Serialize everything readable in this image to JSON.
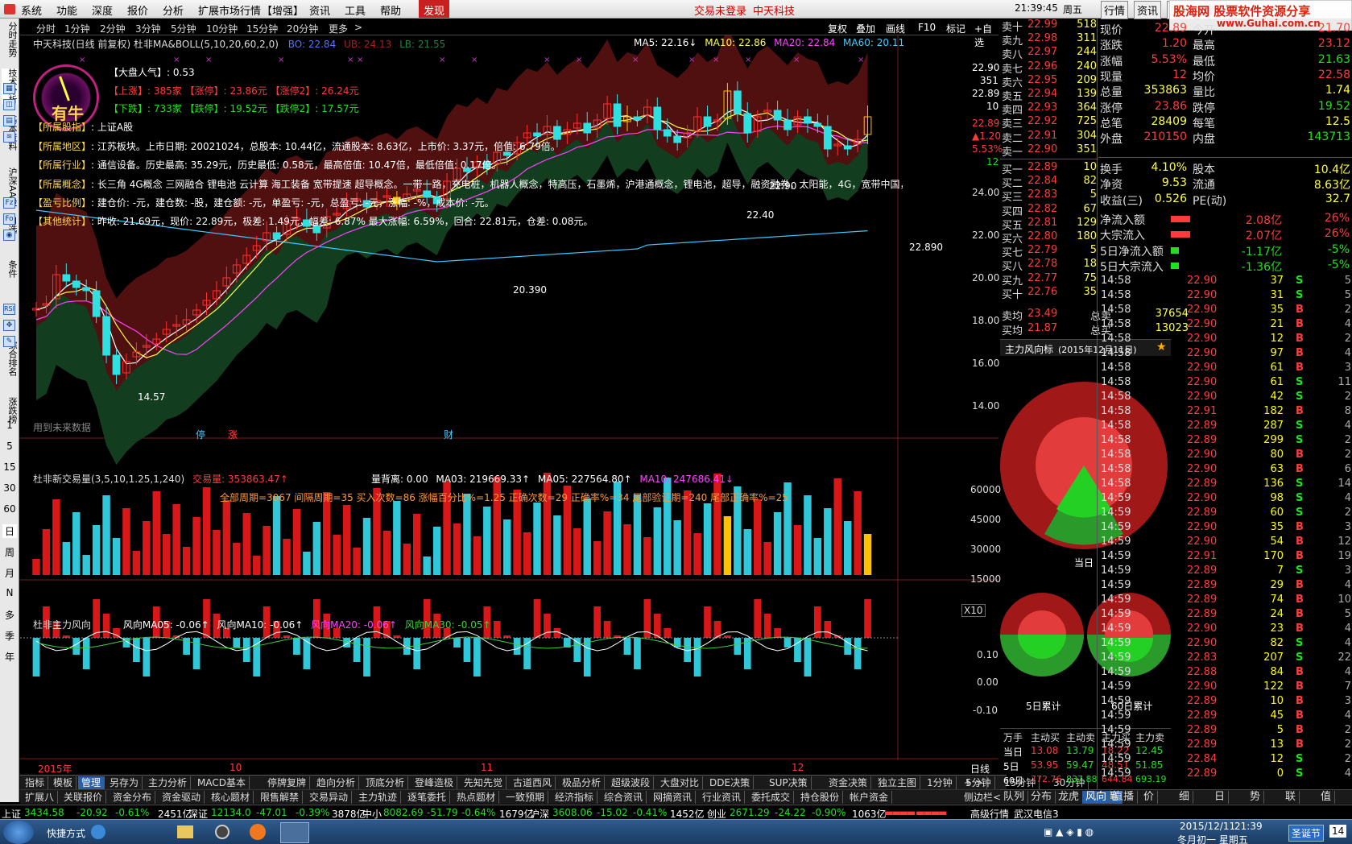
{
  "menubar": {
    "items": [
      "系统",
      "功能",
      "深度",
      "报价",
      "分析",
      "扩展市场行情",
      "【增强】",
      "资讯",
      "工具",
      "帮助",
      "发现"
    ],
    "login_status": "交易未登录",
    "app_name": "中天科技",
    "time": "21:39:45",
    "weekday": "周五",
    "right_buttons": [
      "行情",
      "资讯",
      "交易",
      "服务"
    ],
    "watermark": "股海网 股票软件资源分享",
    "watermark_url": "www.Guhai.com.cn"
  },
  "leftbar": {
    "tabs": [
      "分时走势",
      "技术分析",
      "基本资料",
      "沪深AA股",
      "自选",
      "条件",
      "综合排名",
      "涨跌榜",
      "日"
    ],
    "periods": [
      "1",
      "5",
      "15",
      "30",
      "60",
      "日",
      "周",
      "月",
      "N",
      "多",
      "季",
      "年"
    ]
  },
  "periodbar": {
    "items": [
      "分时",
      "1分钟",
      "2分钟",
      "3分钟",
      "5分钟",
      "10分钟",
      "15分钟",
      "20分钟",
      "更多"
    ],
    "right_items": [
      "复权",
      "叠加",
      "画线",
      "F10",
      "标记",
      "+自选"
    ]
  },
  "main_chart": {
    "title": "中天科技(日线 前复权) 杜非MA&BOLL(5,10,20,60,2,0)",
    "boll": {
      "bo": "BO: 22.84",
      "ub": "UB: 24.13",
      "lb": "LB: 21.55"
    },
    "ma5": "MA5: 22.16↓",
    "ma10": "MA10: 22.86",
    "ma20": "MA20: 22.84",
    "ma60": "MA60: 20.11",
    "gauge_label": "有牛",
    "info_lines": [
      {
        "label": "【大盘人气】",
        "text": ": 0.53"
      },
      {
        "label": "【上涨】",
        "text": ": 385家   【涨停】: 23.86元   【涨停2】: 26.24元"
      },
      {
        "label": "【下跌】",
        "text": ": 733家   【跌停】: 19.52元   【跌停2】: 17.57元"
      },
      {
        "label": "【所属股指】",
        "text": ": 上证A股"
      },
      {
        "label": "【所属地区】",
        "text": ": 江苏板块。上市日期: 20021024，总股本: 10.44亿，流通股本: 8.63亿，上市价: 3.37元，倍值: 6.79倍。"
      },
      {
        "label": "【所属行业】",
        "text": ": 通信设备。历史最高: 35.29元，历史最低: 0.58元，最高倍值: 10.47倍，最低倍值: 0.17倍。"
      },
      {
        "label": "【所属概念】",
        "text": ": 长三角 4G概念 三网融合 锂电池 云计算 海工装备 宽带提速 超导概念。一带一路，充电桩，机器人概念，特高压，石墨烯，沪港通概念，锂电池，超导，融资融券，太阳能，4G，宽带中国，新能源，海"
      },
      {
        "label": "【盈亏比例】",
        "text": ": 建仓价: -元，建仓数: -股，建仓额: -元，单盈亏: -元，总盈亏: -元，涨幅: -%，成本价: -元。"
      },
      {
        "label": "【其他统计】",
        "text": ": 昨收: 21.69元，现价: 22.89元，极差: 1.49元，幅差: 6.87% 最大涨幅: 6.59%，回合: 22.81元，仓差: 0.08元。"
      }
    ],
    "future_note": "用到未来数据",
    "annotations": [
      "14.57",
      "20.390",
      "22.890",
      "22.40",
      "22.90"
    ],
    "y_ticks": [
      "24.00",
      "22.00",
      "20.00",
      "18.00",
      "16.00",
      "14.00"
    ],
    "right_labels": [
      "22.90",
      "351",
      "22.89",
      "10",
      "22.89",
      "▲1.20",
      "5.53%",
      "12"
    ],
    "markers": [
      "停",
      "涨",
      "财"
    ]
  },
  "volume_chart": {
    "title": "杜非新交易量(3,5,10,1.25,1,240)",
    "vol": "交易量: 353863.47↑",
    "li_bei_li": "量背离: 0.00",
    "ma03": "MA03: 219669.33↑",
    "ma05": "MA05: 227564.80↑",
    "ma10": "MA10: 247686.41↓",
    "stats": "全部周期=3067  间隔周期=35  买入次数=86  涨幅百分比%=1.25  正确次数=29  正确率%=34  尾部验证期=240  尾部正确率%=25",
    "y_ticks": [
      "60000",
      "45000",
      "30000",
      "15000"
    ],
    "unit": "X10"
  },
  "wind_chart": {
    "title": "杜非主力风向",
    "ma05": "风向MA05: -0.06↑",
    "ma10": "风向MA10: -0.06↑",
    "ma20": "风向MA20: -0.06↑",
    "ma30": "风向MA30: -0.05↑",
    "y_ticks": [
      "0.10",
      "0.00",
      "-0.10"
    ]
  },
  "x_axis": {
    "labels": [
      "2015年",
      "10",
      "11",
      "12"
    ],
    "right": "日线"
  },
  "bottom_tabs1": [
    "指标",
    "模板",
    "管理",
    "另存为",
    "主力分析",
    "MACD基本",
    "停牌复牌",
    "趋向分析",
    "顶底分析",
    "登峰造极",
    "先知先觉",
    "古道西风",
    "极品分析",
    "超级波段",
    "大盘对比",
    "DDE决策",
    "SUP决策",
    "资金决策",
    "独立主图",
    "1分钟",
    "5分钟",
    "15分钟",
    "30分钟"
  ],
  "bottom_tabs2": [
    "扩展八",
    "关联报价",
    "资金分布",
    "资金驱动",
    "核心题材",
    "限售解禁",
    "交易异动",
    "主力轨迹",
    "逐笔委托",
    "热点题材",
    "一致预期",
    "经济指标",
    "综合资讯",
    "网摘资讯",
    "行业资讯",
    "委托成交",
    "持仓股份",
    "帐户资金"
  ],
  "bottom_right": "侧边栏<",
  "quote": {
    "asks": [
      {
        "label": "卖十",
        "price": "22.99",
        "vol": "518"
      },
      {
        "label": "卖九",
        "price": "22.98",
        "vol": "311"
      },
      {
        "label": "卖八",
        "price": "22.97",
        "vol": "244"
      },
      {
        "label": "卖七",
        "price": "22.96",
        "vol": "240"
      },
      {
        "label": "卖六",
        "price": "22.95",
        "vol": "209"
      },
      {
        "label": "卖五",
        "price": "22.94",
        "vol": "139"
      },
      {
        "label": "卖四",
        "price": "22.93",
        "vol": "364"
      },
      {
        "label": "卖三",
        "price": "22.92",
        "vol": "725"
      },
      {
        "label": "卖二",
        "price": "22.91",
        "vol": "304"
      },
      {
        "label": "卖一",
        "price": "22.90",
        "vol": "351"
      }
    ],
    "bids": [
      {
        "label": "买一",
        "price": "22.89",
        "vol": "10"
      },
      {
        "label": "买二",
        "price": "22.84",
        "vol": "82"
      },
      {
        "label": "买三",
        "price": "22.83",
        "vol": "5"
      },
      {
        "label": "买四",
        "price": "22.82",
        "vol": "67"
      },
      {
        "label": "买五",
        "price": "22.81",
        "vol": "129"
      },
      {
        "label": "买六",
        "price": "22.80",
        "vol": "180"
      },
      {
        "label": "买七",
        "price": "22.79",
        "vol": "5"
      },
      {
        "label": "买八",
        "price": "22.78",
        "vol": "18"
      },
      {
        "label": "买九",
        "price": "22.77",
        "vol": "75"
      },
      {
        "label": "买十",
        "price": "22.76",
        "vol": "35"
      }
    ],
    "avg": [
      {
        "label": "卖均",
        "price": "23.49",
        "k": "总卖",
        "v": "37654"
      },
      {
        "label": "买均",
        "price": "21.87",
        "k": "总买",
        "v": "13023"
      }
    ],
    "stats": [
      {
        "k1": "现价",
        "v1": "22.89",
        "k2": "今开",
        "v2": "21.70"
      },
      {
        "k1": "涨跌",
        "v1": "1.20",
        "k2": "最高",
        "v2": "23.12"
      },
      {
        "k1": "涨幅",
        "v1": "5.53%",
        "k2": "最低",
        "v2": "21.63"
      },
      {
        "k1": "现量",
        "v1": "12",
        "k2": "均价",
        "v2": "22.58"
      },
      {
        "k1": "总量",
        "v1": "353863",
        "k2": "量比",
        "v2": "1.74"
      },
      {
        "k1": "涨停",
        "v1": "23.86",
        "k2": "跌停",
        "v2": "19.52"
      },
      {
        "k1": "总笔",
        "v1": "28409",
        "k2": "每笔",
        "v2": "12.5"
      },
      {
        "k1": "外盘",
        "v1": "210150",
        "k2": "内盘",
        "v2": "143713"
      }
    ],
    "stats2": [
      {
        "k1": "换手",
        "v1": "4.10%",
        "k2": "股本",
        "v2": "10.4亿"
      },
      {
        "k1": "净资",
        "v1": "9.53",
        "k2": "流通",
        "v2": "8.63亿"
      },
      {
        "k1": "收益(三)",
        "v1": "0.526",
        "k2": "PE(动)",
        "v2": "32.7"
      }
    ],
    "flows": [
      {
        "k": "净流入额",
        "v": "2.08亿",
        "p": "26%",
        "bar": "red",
        "ratio": 0.6
      },
      {
        "k": "大宗流入",
        "v": "2.07亿",
        "p": "26%",
        "bar": "red",
        "ratio": 0.6
      },
      {
        "k": "5日净流入额",
        "v": "-1.17亿",
        "p": "-5%",
        "bar": "green",
        "ratio": 0.25
      },
      {
        "k": "5日大宗流入",
        "v": "-1.36亿",
        "p": "-5%",
        "bar": "green",
        "ratio": 0.25
      }
    ]
  },
  "wind_panel": {
    "title": "主力风向标",
    "date": "(2015年12月11日)",
    "labels": [
      "当日",
      "5日累计",
      "60日累计"
    ],
    "table_header": [
      "万手",
      "主动买",
      "主动卖",
      "主力买",
      "主力卖"
    ],
    "table_rows": [
      [
        "当日",
        "13.08",
        "13.79",
        "18.22",
        "12.45"
      ],
      [
        "5日",
        "53.95",
        "59.47",
        "48.51",
        "51.85"
      ],
      [
        "60日",
        "772.76",
        "837.88",
        "644.84",
        "693.19"
      ]
    ],
    "tabs": [
      "队列",
      "分布",
      "龙虎",
      "风向",
      "直播"
    ]
  },
  "ticks": [
    [
      "14:58",
      "22.90",
      "37",
      "S",
      "5"
    ],
    [
      "14:58",
      "22.90",
      "31",
      "S",
      "5"
    ],
    [
      "14:58",
      "22.90",
      "35",
      "B",
      "2"
    ],
    [
      "14:58",
      "22.90",
      "21",
      "B",
      "4"
    ],
    [
      "14:58",
      "22.90",
      "12",
      "B",
      "2"
    ],
    [
      "14:58",
      "22.90",
      "97",
      "B",
      "4"
    ],
    [
      "14:58",
      "22.90",
      "61",
      "B",
      "3"
    ],
    [
      "14:58",
      "22.90",
      "61",
      "S",
      "11"
    ],
    [
      "14:58",
      "22.90",
      "42",
      "S",
      "2"
    ],
    [
      "14:58",
      "22.91",
      "182",
      "B",
      "8"
    ],
    [
      "14:58",
      "22.89",
      "287",
      "S",
      "4"
    ],
    [
      "14:58",
      "22.89",
      "299",
      "S",
      "2"
    ],
    [
      "14:58",
      "22.90",
      "80",
      "B",
      "2"
    ],
    [
      "14:58",
      "22.90",
      "63",
      "B",
      "6"
    ],
    [
      "14:58",
      "22.89",
      "136",
      "S",
      "14"
    ],
    [
      "14:59",
      "22.90",
      "98",
      "S",
      "4"
    ],
    [
      "14:59",
      "22.89",
      "60",
      "S",
      "2"
    ],
    [
      "14:59",
      "22.90",
      "35",
      "B",
      "3"
    ],
    [
      "14:59",
      "22.90",
      "54",
      "B",
      "12"
    ],
    [
      "14:59",
      "22.91",
      "170",
      "B",
      "19"
    ],
    [
      "14:59",
      "22.89",
      "7",
      "S",
      "3"
    ],
    [
      "14:59",
      "22.89",
      "29",
      "B",
      "4"
    ],
    [
      "14:59",
      "22.89",
      "74",
      "B",
      "10"
    ],
    [
      "14:59",
      "22.89",
      "24",
      "B",
      "5"
    ],
    [
      "14:59",
      "22.90",
      "23",
      "B",
      "4"
    ],
    [
      "14:59",
      "22.90",
      "82",
      "S",
      "4"
    ],
    [
      "14:59",
      "22.83",
      "207",
      "S",
      "22"
    ],
    [
      "14:59",
      "22.88",
      "84",
      "B",
      "4"
    ],
    [
      "14:59",
      "22.90",
      "122",
      "B",
      "7"
    ],
    [
      "14:59",
      "22.89",
      "10",
      "B",
      "3"
    ],
    [
      "14:59",
      "22.89",
      "45",
      "B",
      "4"
    ],
    [
      "14:59",
      "22.89",
      "5",
      "B",
      "2"
    ],
    [
      "14:59",
      "22.89",
      "13",
      "B",
      "2"
    ],
    [
      "14:59",
      "22.84",
      "12",
      "S",
      "2"
    ],
    [
      "14:59",
      "22.89",
      "0",
      "S",
      "4"
    ]
  ],
  "ticks_tabs": [
    "笔",
    "价",
    "细",
    "日",
    "势",
    "联",
    "值"
  ],
  "statusbar": {
    "sh": {
      "name": "上证",
      "price": "3434.58",
      "chg": "-20.92",
      "pct": "-0.61%",
      "amt": "2451亿"
    },
    "sz": {
      "name": "深证",
      "price": "12134.0",
      "chg": "-47.01",
      "pct": "-0.39%",
      "amt": "3878亿"
    },
    "zx": {
      "name": "中小",
      "price": "8082.69",
      "chg": "-51.79",
      "pct": "-0.64%",
      "amt": "1679亿"
    },
    "hs": {
      "name": "沪深",
      "price": "3608.06",
      "chg": "-15.02",
      "pct": "-0.41%",
      "amt": "1452亿"
    },
    "cy": {
      "name": "创业",
      "price": "2671.29",
      "chg": "-24.22",
      "pct": "-0.90%",
      "amt": "1063亿"
    },
    "feed": "高级行情_武汉电信3"
  },
  "taskbar": {
    "quick_launch": "快捷方式",
    "clock_time": "21:39",
    "clock_date": "2015/12/11",
    "lunar": "冬月初一 星期五",
    "holiday": "圣诞节",
    "days": "14"
  },
  "colors": {
    "up": "#ff3b3b",
    "down": "#20e020",
    "accent": "#ffff40",
    "cyan": "#33ffff"
  }
}
